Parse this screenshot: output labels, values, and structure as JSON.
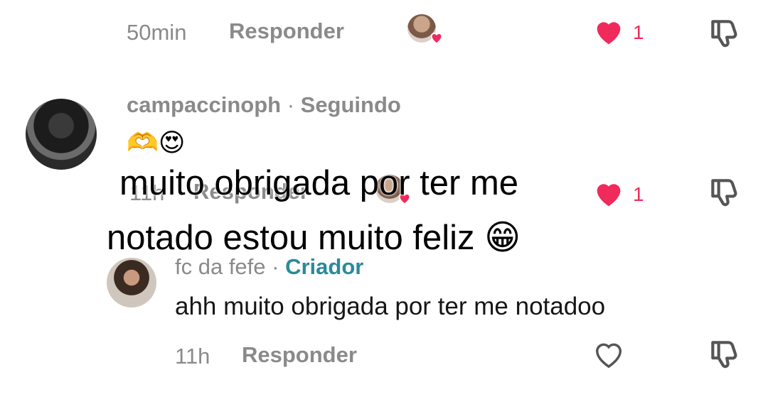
{
  "top_row": {
    "time": "50min",
    "reply_label": "Responder",
    "like_count": "1"
  },
  "comment1": {
    "username": "campaccinoph",
    "separator": "·",
    "status": "Seguindo",
    "body_emoji": "🫶😍",
    "time": "11h",
    "reply_label": "Responder",
    "like_count": "1"
  },
  "caption": {
    "line1": "muito obrigada por ter me",
    "line2": "notado estou muito feliz 😁"
  },
  "reply": {
    "username": "fc da fefe",
    "separator": "·",
    "badge": "Criador",
    "body": "ahh muito obrigada por ter me notadoo",
    "time": "11h",
    "reply_label": "Responder"
  },
  "colors": {
    "accent_heart": "#f02a5a",
    "creator_badge": "#2b8a9a",
    "muted_text": "#8a8a8a"
  },
  "icons": [
    "creator-liked-avatar-icon",
    "heart-filled-icon",
    "heart-outline-icon",
    "dislike-icon"
  ]
}
